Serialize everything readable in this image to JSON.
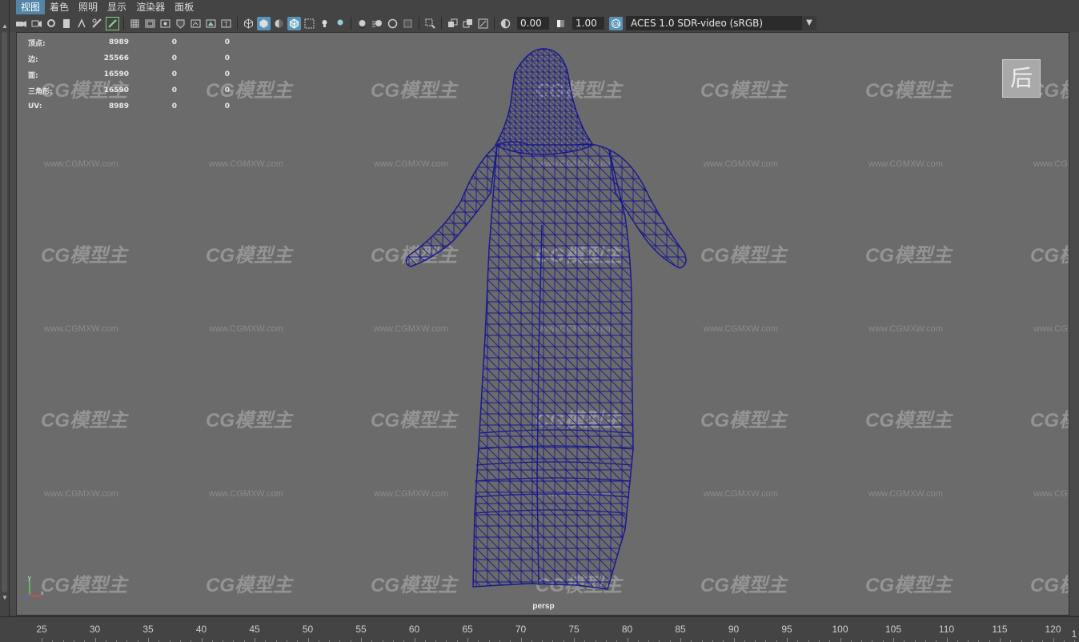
{
  "menu": [
    "视图",
    "着色",
    "照明",
    "显示",
    "渲染器",
    "面板"
  ],
  "toolbar": {
    "exposure": "0.00",
    "gamma": "1.00",
    "colorspace": "ACES 1.0 SDR-video (sRGB)"
  },
  "hud": [
    {
      "label": "顶点:",
      "v1": "8989",
      "v2": "0",
      "v3": "0"
    },
    {
      "label": "边:",
      "v1": "25566",
      "v2": "0",
      "v3": "0"
    },
    {
      "label": "面:",
      "v1": "16590",
      "v2": "0",
      "v3": "0"
    },
    {
      "label": "三角形:",
      "v1": "16590",
      "v2": "0",
      "v3": "0"
    },
    {
      "label": "UV:",
      "v1": "8989",
      "v2": "0",
      "v3": "0"
    }
  ],
  "view_cube_label": "后",
  "camera": "persp",
  "axis": {
    "y": "y",
    "x": "x"
  },
  "watermark": {
    "logo": "CG模型主",
    "url": "www.CGMXW.com"
  },
  "timeline": [
    "25",
    "30",
    "35",
    "40",
    "45",
    "50",
    "55",
    "60",
    "65",
    "70",
    "75",
    "80",
    "85",
    "90",
    "95",
    "100",
    "105",
    "110",
    "115",
    "120"
  ],
  "timeline_right": "1",
  "colors": {
    "wireframe": "#1a1a8c",
    "viewport": "#6b6b6b",
    "accent": "#5285a6"
  }
}
